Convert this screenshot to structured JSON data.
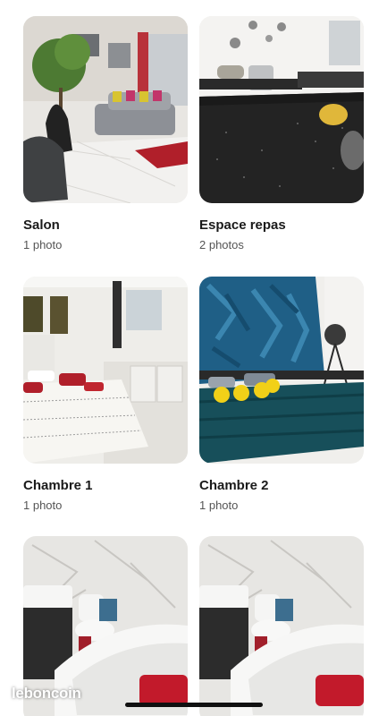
{
  "gallery": {
    "rooms": [
      {
        "title": "Salon",
        "count": "1 photo",
        "thumb": "living-room-photo"
      },
      {
        "title": "Espace repas",
        "count": "2 photos",
        "thumb": "dining-area-photo"
      },
      {
        "title": "Chambre 1",
        "count": "1 photo",
        "thumb": "bedroom-1-photo"
      },
      {
        "title": "Chambre 2",
        "count": "1 photo",
        "thumb": "bedroom-2-photo"
      },
      {
        "title": "",
        "count": "",
        "thumb": "bathroom-photo"
      },
      {
        "title": "",
        "count": "",
        "thumb": "bathroom-photo"
      }
    ]
  },
  "brand": {
    "watermark": "leboncoin"
  },
  "colors": {
    "text": "#1a1a1a",
    "subtext": "#555555",
    "background": "#ffffff"
  }
}
